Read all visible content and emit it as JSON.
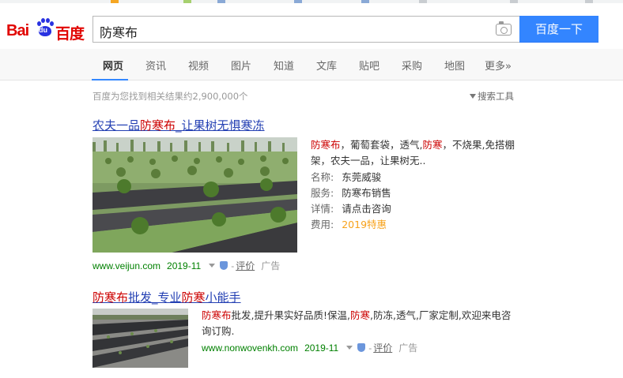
{
  "header": {
    "logo_text_latin": "Bai",
    "logo_paw_text": "du",
    "logo_text_cn": "百度",
    "query": "防寒布",
    "search_button": "百度一下"
  },
  "tabs": [
    {
      "label": "网页",
      "active": true
    },
    {
      "label": "资讯"
    },
    {
      "label": "视频"
    },
    {
      "label": "图片"
    },
    {
      "label": "知道"
    },
    {
      "label": "文库"
    },
    {
      "label": "贴吧"
    },
    {
      "label": "采购"
    },
    {
      "label": "地图"
    },
    {
      "label": "更多»"
    }
  ],
  "result_count": "百度为您找到相关结果约2,900,000个",
  "search_tools": "搜索工具",
  "results": [
    {
      "title_pre": "农夫一品",
      "title_em": "防寒布",
      "title_post": "_让果树无惧寒冻",
      "desc_em1": "防寒布",
      "desc_t1": "，葡萄套袋，透气,",
      "desc_em2": "防寒",
      "desc_t2": "，不烧果,免搭棚架，农夫一品，让果树无..",
      "fields": [
        {
          "k": "名称:",
          "v": "东莞威骏"
        },
        {
          "k": "服务:",
          "v": "防寒布销售"
        },
        {
          "k": "详情:",
          "v": "请点击咨询"
        },
        {
          "k": "费用:",
          "v": "2019特惠"
        }
      ],
      "url": "www.veijun.com",
      "date": "2019-11",
      "dash": "-",
      "review": "评价",
      "ad": "广告"
    },
    {
      "title_em1": "防寒布",
      "title_t1": "批发_专业",
      "title_em2": "防寒",
      "title_t2": "小能手",
      "desc_em1": "防寒布",
      "desc_t1": "批发,提升果实好品质!保温,",
      "desc_em2": "防寒",
      "desc_t2": ",防冻,透气,厂家定制,欢迎来电咨询订购.",
      "url": "www.nonwovenkh.com",
      "date": "2019-11",
      "dash": "-",
      "review": "评价",
      "ad": "广告"
    }
  ],
  "colors": {
    "brand_red": "#e10602",
    "brand_blue": "#2932e1",
    "button_blue": "#3385ff",
    "link_blue": "#2440b3",
    "highlight_red": "#c00",
    "url_green": "#008000",
    "offer_orange": "#f7a21b"
  },
  "icons": [
    "camera-icon",
    "funnel-icon",
    "caret-down-icon",
    "shield-icon",
    "paw-icon"
  ]
}
